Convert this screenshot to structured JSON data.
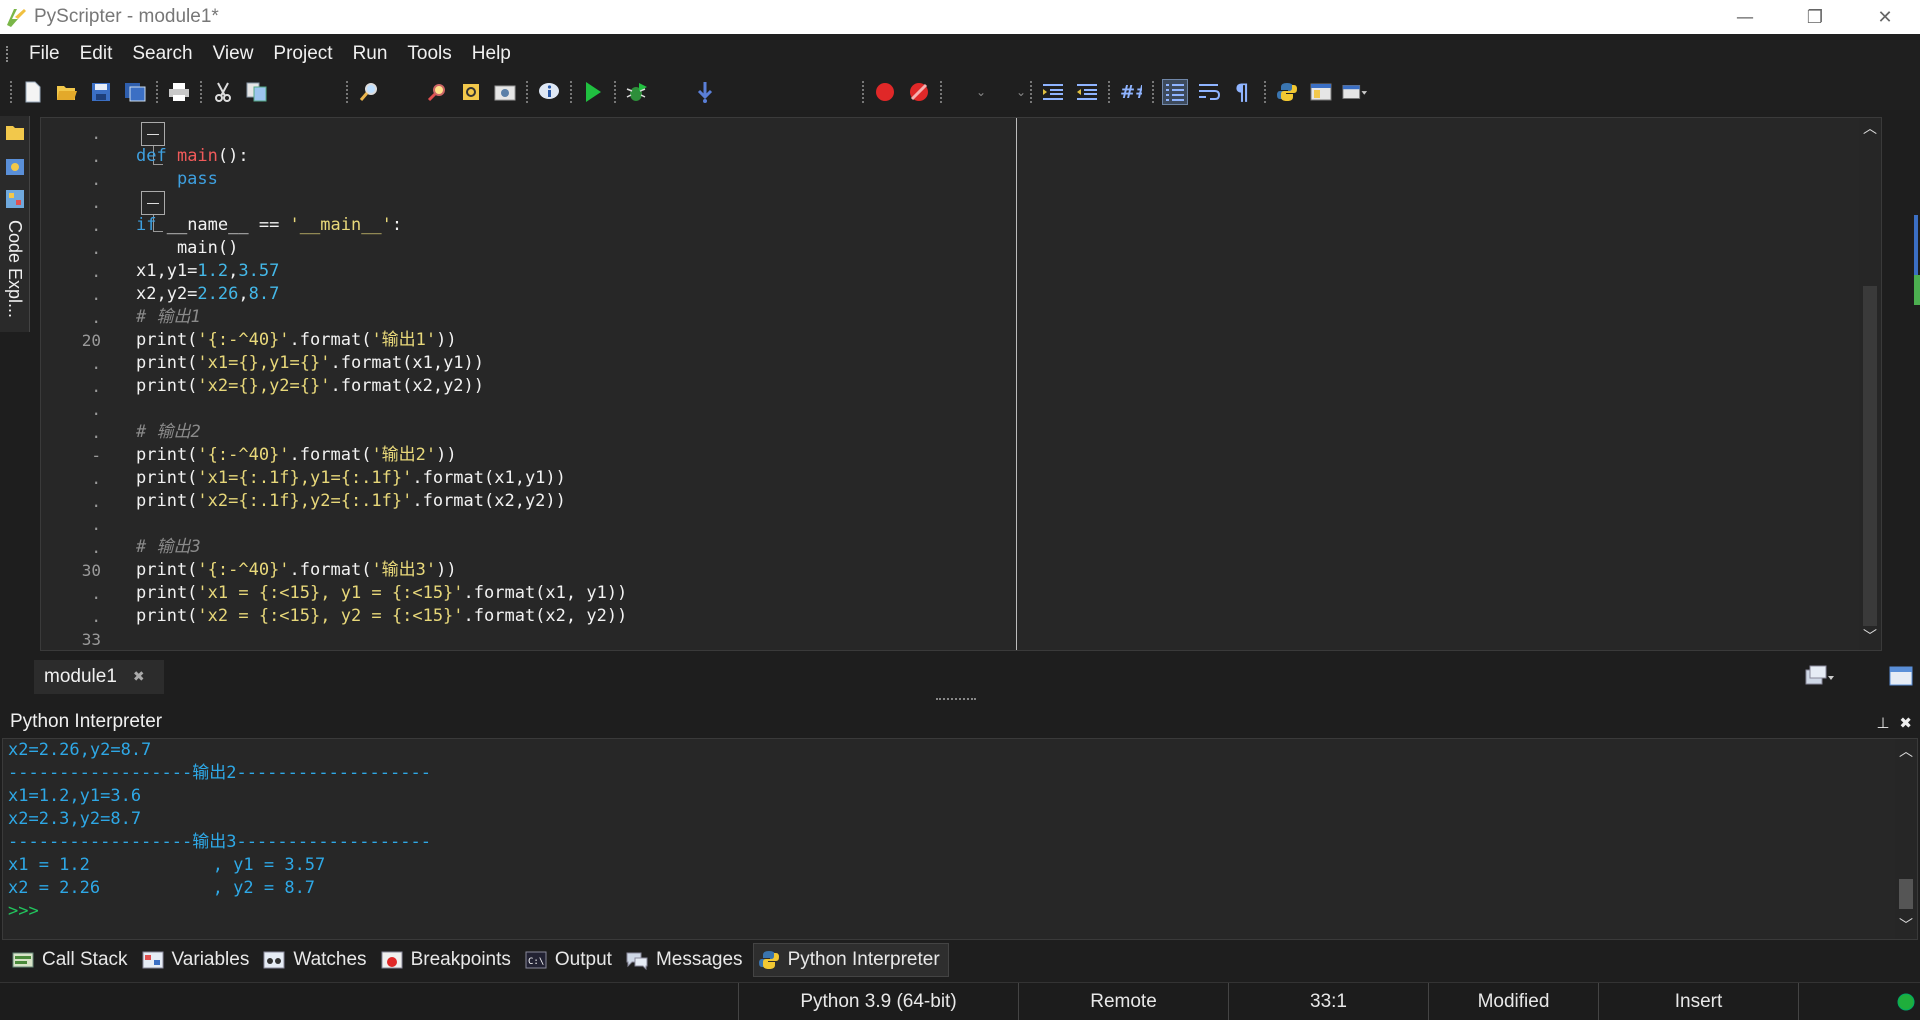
{
  "window": {
    "title": "PyScripter - module1*",
    "app_icon": "pyscripter-logo-icon",
    "buttons": [
      "minimize",
      "restore",
      "close"
    ]
  },
  "menu": [
    "File",
    "Edit",
    "Search",
    "View",
    "Project",
    "Run",
    "Tools",
    "Help"
  ],
  "toolbar": {
    "icons": [
      "new-file-icon",
      "open-file-icon",
      "save-icon",
      "save-all-icon",
      "print-icon",
      "cut-icon",
      "copy-icon",
      "find-icon",
      "find-in-files-icon",
      "replace-icon",
      "screenshot-icon",
      "info-icon",
      "run-icon",
      "debug-icon",
      "step-into-icon",
      "toggle-breakpoint-icon",
      "clear-breakpoints-icon",
      "indent-icon",
      "dedent-icon",
      "comment-icon",
      "line-numbers-icon",
      "word-wrap-icon",
      "pilcrow-icon",
      "python-icon",
      "layout-icon",
      "layout-dropdown-icon"
    ]
  },
  "side_panel": {
    "label": "Code Expl..."
  },
  "editor": {
    "gutter": [
      ".",
      ".",
      ".",
      ".",
      ".",
      ".",
      ".",
      ".",
      ".",
      "20",
      ".",
      ".",
      ".",
      ".",
      "-",
      ".",
      ".",
      ".",
      ".",
      "30",
      ".",
      ".",
      "33"
    ],
    "lines": [
      [],
      [
        {
          "t": "def ",
          "c": "kw"
        },
        {
          "t": "main",
          "c": "fn"
        },
        {
          "t": "():",
          "c": "op"
        }
      ],
      [
        {
          "t": "    pass",
          "c": "kw"
        }
      ],
      [],
      [
        {
          "t": "if ",
          "c": "kw"
        },
        {
          "t": "__name__ == ",
          "c": "tx"
        },
        {
          "t": "'__main__'",
          "c": "str"
        },
        {
          "t": ":",
          "c": "op"
        }
      ],
      [
        {
          "t": "    main()",
          "c": "tx"
        }
      ],
      [
        {
          "t": "x1,y1=",
          "c": "tx"
        },
        {
          "t": "1.2",
          "c": "num"
        },
        {
          "t": ",",
          "c": "op"
        },
        {
          "t": "3.57",
          "c": "num"
        }
      ],
      [
        {
          "t": "x2,y2=",
          "c": "tx"
        },
        {
          "t": "2.26",
          "c": "num"
        },
        {
          "t": ",",
          "c": "op"
        },
        {
          "t": "8.7",
          "c": "num"
        }
      ],
      [
        {
          "t": "# 输出1",
          "c": "cm"
        }
      ],
      [
        {
          "t": "print(",
          "c": "tx"
        },
        {
          "t": "'{:-^40}'",
          "c": "str"
        },
        {
          "t": ".format(",
          "c": "tx"
        },
        {
          "t": "'输出1'",
          "c": "str"
        },
        {
          "t": "))",
          "c": "tx"
        }
      ],
      [
        {
          "t": "print(",
          "c": "tx"
        },
        {
          "t": "'x1={},y1={}'",
          "c": "str"
        },
        {
          "t": ".format(x1,y1))",
          "c": "tx"
        }
      ],
      [
        {
          "t": "print(",
          "c": "tx"
        },
        {
          "t": "'x2={},y2={}'",
          "c": "str"
        },
        {
          "t": ".format(x2,y2))",
          "c": "tx"
        }
      ],
      [],
      [
        {
          "t": "# 输出2",
          "c": "cm"
        }
      ],
      [
        {
          "t": "print(",
          "c": "tx"
        },
        {
          "t": "'{:-^40}'",
          "c": "str"
        },
        {
          "t": ".format(",
          "c": "tx"
        },
        {
          "t": "'输出2'",
          "c": "str"
        },
        {
          "t": "))",
          "c": "tx"
        }
      ],
      [
        {
          "t": "print(",
          "c": "tx"
        },
        {
          "t": "'x1={:.1f},y1={:.1f}'",
          "c": "str"
        },
        {
          "t": ".format(x1,y1))",
          "c": "tx"
        }
      ],
      [
        {
          "t": "print(",
          "c": "tx"
        },
        {
          "t": "'x2={:.1f},y2={:.1f}'",
          "c": "str"
        },
        {
          "t": ".format(x2,y2))",
          "c": "tx"
        }
      ],
      [],
      [
        {
          "t": "# 输出3",
          "c": "cm"
        }
      ],
      [
        {
          "t": "print(",
          "c": "tx"
        },
        {
          "t": "'{:-^40}'",
          "c": "str"
        },
        {
          "t": ".format(",
          "c": "tx"
        },
        {
          "t": "'输出3'",
          "c": "str"
        },
        {
          "t": "))",
          "c": "tx"
        }
      ],
      [
        {
          "t": "print(",
          "c": "tx"
        },
        {
          "t": "'x1 = {:<15}, y1 = {:<15}'",
          "c": "str"
        },
        {
          "t": ".format(x1, y1))",
          "c": "tx"
        }
      ],
      [
        {
          "t": "print(",
          "c": "tx"
        },
        {
          "t": "'x2 = {:<15}, y2 = {:<15}'",
          "c": "str"
        },
        {
          "t": ".format(x2, y2))",
          "c": "tx"
        }
      ],
      []
    ]
  },
  "doc_tab": {
    "label": "module1",
    "close_glyph": "✖"
  },
  "interpreter": {
    "title": "Python Interpreter",
    "pin_glyph": "📌",
    "close_glyph": "✖",
    "output": [
      "x2=2.26,y2=8.7",
      "------------------输出2-------------------",
      "x1=1.2,y1=3.6",
      "x2=2.3,y2=8.7",
      "------------------输出3-------------------",
      "x1 = 1.2            , y1 = 3.57",
      "x2 = 2.26           , y2 = 8.7"
    ],
    "prompt": ">>>"
  },
  "bottom_tabs": [
    {
      "label": "Call Stack",
      "icon": "call-stack-icon"
    },
    {
      "label": "Variables",
      "icon": "variables-icon"
    },
    {
      "label": "Watches",
      "icon": "watches-icon"
    },
    {
      "label": "Breakpoints",
      "icon": "breakpoints-icon"
    },
    {
      "label": "Output",
      "icon": "output-icon"
    },
    {
      "label": "Messages",
      "icon": "messages-icon"
    },
    {
      "label": "Python Interpreter",
      "icon": "python-icon",
      "active": true
    }
  ],
  "status": {
    "python_version": "Python 3.9 (64-bit)",
    "engine": "Remote",
    "position": "33:1",
    "modified": "Modified",
    "mode": "Insert"
  },
  "colors": {
    "keyword": "#3ea0e0",
    "function": "#f05a5a",
    "string": "#e8d87a",
    "number": "#44b8e8",
    "comment": "#8a8a8a",
    "interpreter_output": "#2ea8e6",
    "prompt": "#22c55e"
  }
}
